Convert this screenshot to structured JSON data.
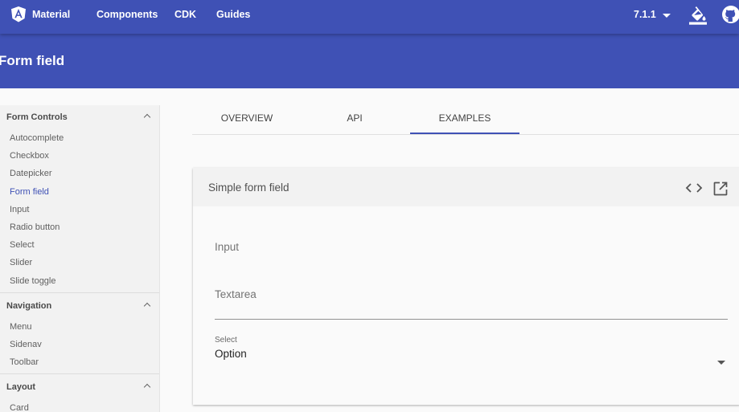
{
  "topbar": {
    "brand_label": "Material",
    "nav": [
      "Components",
      "CDK",
      "Guides"
    ],
    "version": "7.1.1",
    "background": "#3f51b5"
  },
  "header": {
    "title": "Form field"
  },
  "sidebar": {
    "sections": [
      {
        "title": "Form Controls",
        "items": [
          "Autocomplete",
          "Checkbox",
          "Datepicker",
          "Form field",
          "Input",
          "Radio button",
          "Select",
          "Slider",
          "Slide toggle"
        ]
      },
      {
        "title": "Navigation",
        "items": [
          "Menu",
          "Sidenav",
          "Toolbar"
        ]
      },
      {
        "title": "Layout",
        "items": [
          "Card"
        ]
      }
    ],
    "active_item": "Form field"
  },
  "tabs": {
    "items": [
      "OVERVIEW",
      "API",
      "EXAMPLES"
    ],
    "active": "EXAMPLES"
  },
  "example": {
    "title": "Simple form field",
    "input_label": "Input",
    "textarea_label": "Textarea",
    "select_label": "Select",
    "select_value": "Option"
  },
  "icons": {
    "brand": "angular-shield-icon",
    "theme": "format-color-fill-icon",
    "github": "github-icon",
    "code": "code-icon",
    "open": "open-in-new-icon",
    "dropdown": "arrow-drop-down-icon",
    "collapse": "chevron-up-icon"
  }
}
